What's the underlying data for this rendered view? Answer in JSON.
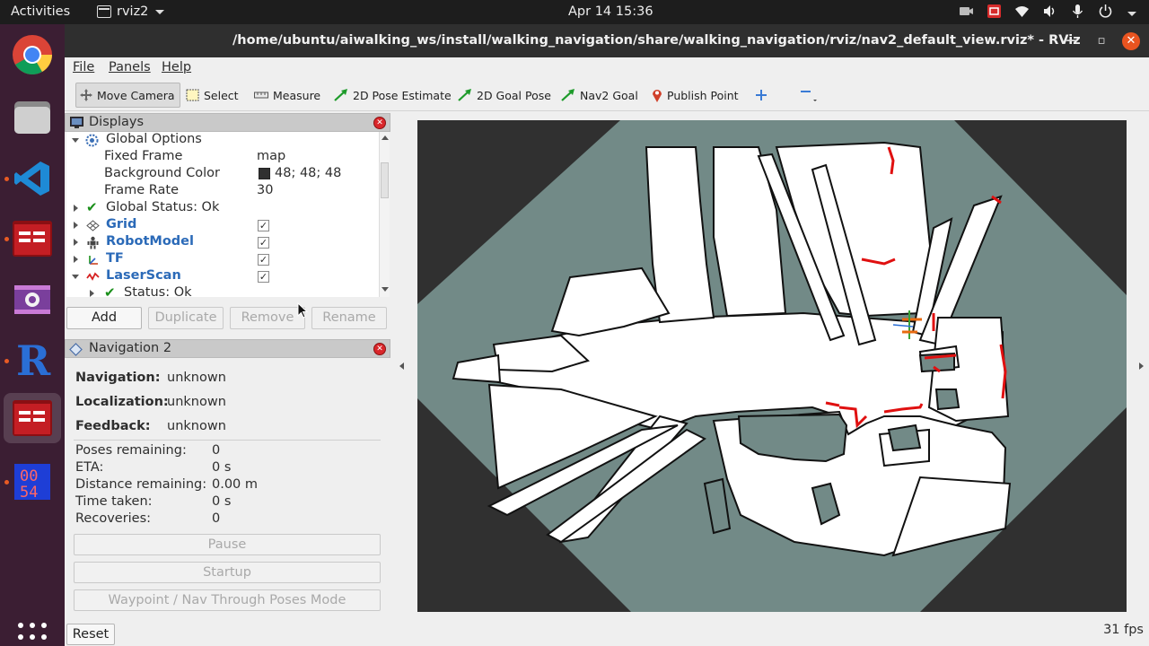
{
  "topbar": {
    "activities": "Activities",
    "app_name": "rviz2",
    "clock": "Apr 14  15:36"
  },
  "dock": {
    "items": [
      "chrome-icon",
      "files-icon",
      "vscode-icon",
      "terminal-icon",
      "video-icon",
      "rviz-icon",
      "terminal-icon",
      "number-icon"
    ]
  },
  "window": {
    "title": "/home/ubuntu/aiwalking_ws/install/walking_navigation/share/walking_navigation/rviz/nav2_default_view.rviz* - RViz"
  },
  "menu": {
    "file": "File",
    "panels": "Panels",
    "help": "Help"
  },
  "toolbar": {
    "move_camera": "Move Camera",
    "select": "Select",
    "measure": "Measure",
    "pose_estimate": "2D Pose Estimate",
    "goal_pose": "2D Goal Pose",
    "nav2_goal": "Nav2 Goal",
    "publish_point": "Publish Point"
  },
  "displays": {
    "title": "Displays",
    "global_options": "Global Options",
    "fixed_frame_label": "Fixed Frame",
    "fixed_frame_value": "map",
    "bg_color_label": "Background Color",
    "bg_color_value": "48; 48; 48",
    "frame_rate_label": "Frame Rate",
    "frame_rate_value": "30",
    "global_status": "Global Status: Ok",
    "grid": "Grid",
    "robot_model": "RobotModel",
    "tf": "TF",
    "laser_scan": "LaserScan",
    "status_ok": "Status: Ok",
    "buttons": {
      "add": "Add",
      "duplicate": "Duplicate",
      "remove": "Remove",
      "rename": "Rename"
    }
  },
  "nav2": {
    "title": "Navigation 2",
    "navigation_label": "Navigation:",
    "navigation_value": "unknown",
    "localization_label": "Localization:",
    "localization_value": "unknown",
    "feedback_label": "Feedback:",
    "feedback_value": "unknown",
    "poses_remaining_label": "Poses remaining:",
    "poses_remaining_value": "0",
    "eta_label": "ETA:",
    "eta_value": "0 s",
    "distance_label": "Distance remaining:",
    "distance_value": "0.00 m",
    "time_taken_label": "Time taken:",
    "time_taken_value": "0 s",
    "recoveries_label": "Recoveries:",
    "recoveries_value": "0",
    "pause": "Pause",
    "startup": "Startup",
    "waypoint_mode": "Waypoint / Nav Through Poses Mode"
  },
  "status": {
    "reset": "Reset",
    "fps": "31 fps"
  },
  "colors": {
    "accent": "#e95420",
    "dock_bg": "#3b1e33",
    "map_unknown": "#728a87",
    "map_free": "#ffffff",
    "laser": "#e01010",
    "rviz_bg": "#303030"
  }
}
